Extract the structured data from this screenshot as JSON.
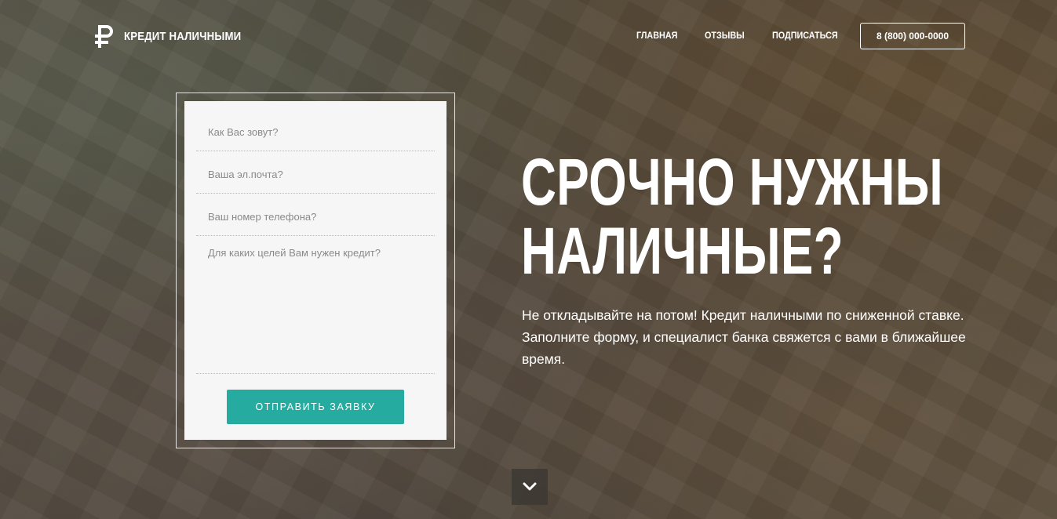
{
  "logo": {
    "icon": "ruble-icon",
    "text": "КРЕДИТ НАЛИЧНЫМИ"
  },
  "nav": {
    "items": [
      {
        "label": "ГЛАВНАЯ"
      },
      {
        "label": "ОТЗЫВЫ"
      },
      {
        "label": "ПОДПИСАТЬСЯ"
      }
    ],
    "phone": "8 (800) 000-0000"
  },
  "form": {
    "name_placeholder": "Как Вас зовут?",
    "email_placeholder": "Ваша эл.почта?",
    "phone_placeholder": "Ваш номер телефона?",
    "purpose_placeholder": "Для каких целей Вам нужен кредит?",
    "submit_label": "ОТПРАВИТЬ ЗАЯВКУ",
    "accent_color": "#25ab9f"
  },
  "hero": {
    "title_line1": "СРОЧНО НУЖНЫ",
    "title_line2": "НАЛИЧНЫЕ?",
    "text": "Не откладывайте на потом! Кредит наличными по сниженной ставке. Заполните форму, и специалист банка свяжется с вами в ближайшее время."
  },
  "scroll": {
    "icon": "chevron-down-icon"
  }
}
